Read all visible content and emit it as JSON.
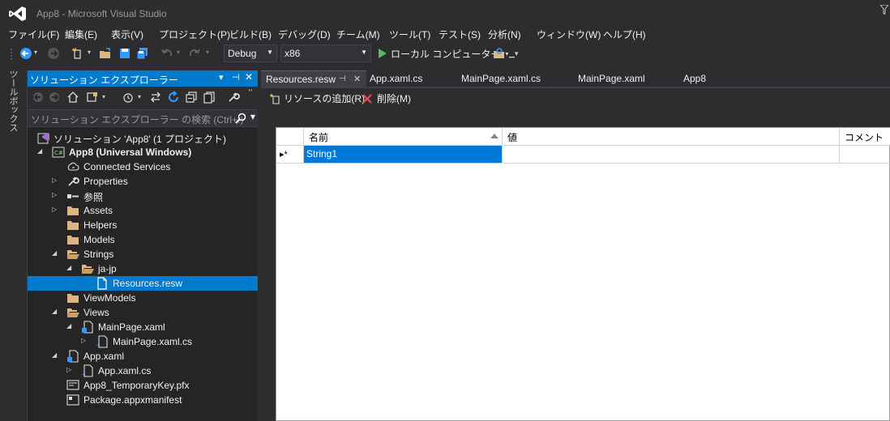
{
  "window": {
    "title": "App8 - Microsoft Visual Studio"
  },
  "menu": [
    "ファイル(F)",
    "編集(E)",
    "表示(V)",
    "プロジェクト(P)",
    "ビルド(B)",
    "デバッグ(D)",
    "チーム(M)",
    "ツール(T)",
    "テスト(S)",
    "分析(N)",
    "ウィンドウ(W)",
    "ヘルプ(H)"
  ],
  "toolbar": {
    "configuration": "Debug",
    "platform": "x86",
    "run_label": "ローカル コンピューター"
  },
  "toolbox": {
    "label": "ツールボックス"
  },
  "solution_explorer": {
    "title": "ソリューション エクスプローラー",
    "search_placeholder": "ソリューション エクスプローラー の検索 (Ctrl+:)",
    "items": [
      {
        "label": "ソリューション 'App8' (1 プロジェクト)",
        "icon": "solution-icon",
        "bold": false
      },
      {
        "label": "App8 (Universal Windows)",
        "icon": "csharp-project-icon",
        "bold": true
      },
      {
        "label": "Connected Services",
        "icon": "connected-services-icon",
        "bold": false
      },
      {
        "label": "Properties",
        "icon": "wrench-icon",
        "bold": false
      },
      {
        "label": "参照",
        "icon": "references-icon",
        "bold": false
      },
      {
        "label": "Assets",
        "icon": "folder-icon",
        "bold": false
      },
      {
        "label": "Helpers",
        "icon": "folder-icon",
        "bold": false
      },
      {
        "label": "Models",
        "icon": "folder-icon",
        "bold": false
      },
      {
        "label": "Strings",
        "icon": "folder-open-icon",
        "bold": false
      },
      {
        "label": "ja-jp",
        "icon": "folder-open-icon",
        "bold": false
      },
      {
        "label": "Resources.resw",
        "icon": "file-icon",
        "bold": false
      },
      {
        "label": "ViewModels",
        "icon": "folder-icon",
        "bold": false
      },
      {
        "label": "Views",
        "icon": "folder-open-icon",
        "bold": false
      },
      {
        "label": "MainPage.xaml",
        "icon": "xaml-file-icon",
        "bold": false
      },
      {
        "label": "MainPage.xaml.cs",
        "icon": "cs-file-icon",
        "bold": false
      },
      {
        "label": "App.xaml",
        "icon": "xaml-file-icon",
        "bold": false
      },
      {
        "label": "App.xaml.cs",
        "icon": "cs-file-icon",
        "bold": false
      },
      {
        "label": "App8_TemporaryKey.pfx",
        "icon": "certificate-icon",
        "bold": false
      },
      {
        "label": "Package.appxmanifest",
        "icon": "manifest-icon",
        "bold": false
      }
    ]
  },
  "document_tabs": [
    {
      "label": "Resources.resw",
      "active": true
    },
    {
      "label": "App.xaml.cs",
      "active": false
    },
    {
      "label": "MainPage.xaml.cs",
      "active": false
    },
    {
      "label": "MainPage.xaml",
      "active": false
    },
    {
      "label": "App8",
      "active": false
    }
  ],
  "resource_editor": {
    "add_resource_label": "リソースの追加(R)",
    "delete_label": "削除(M)",
    "columns": [
      "名前",
      "値",
      "コメント"
    ],
    "rows": [
      {
        "marker": "▸*",
        "name": "String1",
        "value": "",
        "comment": ""
      }
    ]
  },
  "colors": {
    "accent": "#007acc",
    "background": "#2d2d30",
    "panel": "#252526"
  }
}
